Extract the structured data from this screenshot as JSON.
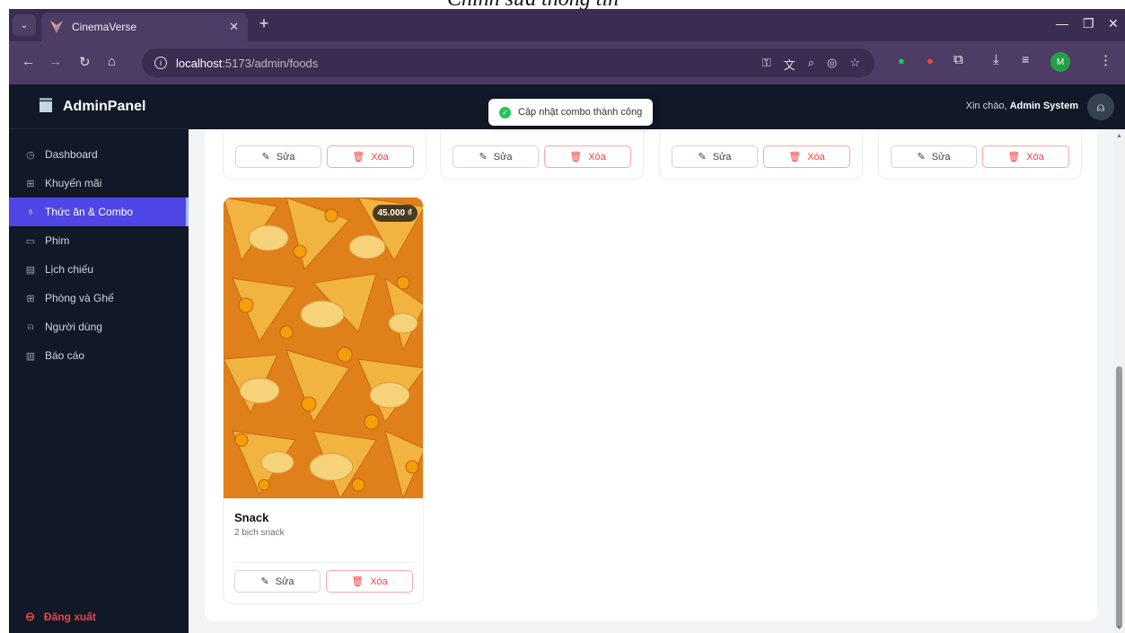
{
  "caption": {
    "text": "Chỉnh sửa thông tin"
  },
  "browser": {
    "tab_title": "CinemaVerse",
    "url_host": "localhost",
    "url_path": ":5173/admin/foods",
    "profile_initial": "M"
  },
  "sidebar": {
    "brand": "AdminPanel",
    "items": [
      {
        "label": "Dashboard",
        "icon": "dashboard-icon"
      },
      {
        "label": "Khuyến mãi",
        "icon": "gift-icon"
      },
      {
        "label": "Thức ăn & Combo",
        "icon": "food-icon",
        "active": true
      },
      {
        "label": "Phim",
        "icon": "film-icon"
      },
      {
        "label": "Lịch chiếu",
        "icon": "calendar-icon"
      },
      {
        "label": "Phòng và Ghế",
        "icon": "grid-icon"
      },
      {
        "label": "Người dùng",
        "icon": "user-icon"
      },
      {
        "label": "Báo cáo",
        "icon": "chart-icon"
      }
    ],
    "logout": "Đăng xuất"
  },
  "header": {
    "greeting": "Xin chào,",
    "user_name": "Admin System"
  },
  "toast": {
    "message": "Cập nhật combo thành công"
  },
  "actions": {
    "edit": "Sửa",
    "delete": "Xóa"
  },
  "product": {
    "name": "Snack",
    "description": "2 bịch snack",
    "price": "45.000 ₫"
  },
  "colors": {
    "sidebar": "#111827",
    "active": "#4f46e5",
    "danger": "#ef4444",
    "success": "#22c55e"
  }
}
